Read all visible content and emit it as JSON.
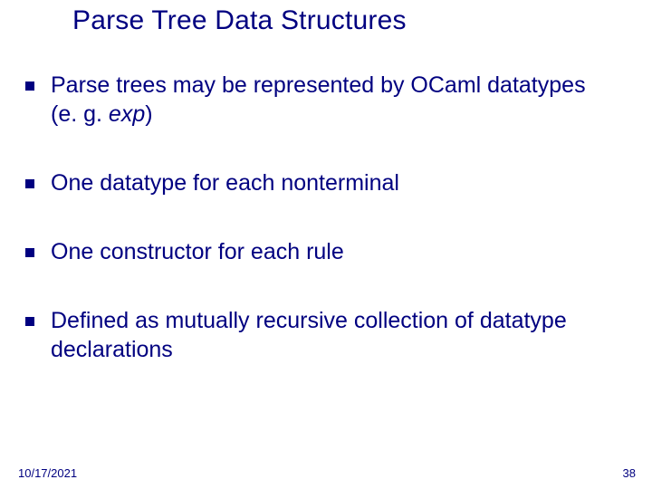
{
  "title": "Parse Tree Data Structures",
  "bullets": {
    "b1_pre": "Parse trees may be represented by OCaml datatypes (e. g. ",
    "b1_it": "exp",
    "b1_post": ")",
    "b2": "One datatype for each nonterminal",
    "b3": "One constructor for each rule",
    "b4": "Defined as mutually recursive collection of datatype declarations"
  },
  "footer": {
    "date": "10/17/2021",
    "page": "38"
  }
}
